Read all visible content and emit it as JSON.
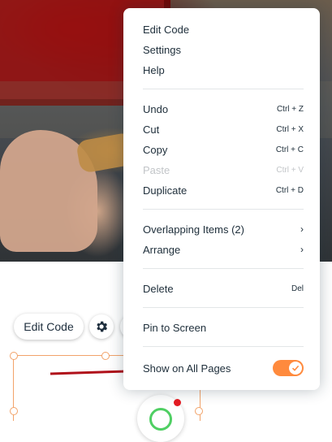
{
  "editor": {
    "edit_code_button": "Edit Code"
  },
  "menu": {
    "items": [
      {
        "label": "Edit Code"
      },
      {
        "label": "Settings"
      },
      {
        "label": "Help"
      },
      {
        "label": "Undo",
        "shortcut": "Ctrl + Z"
      },
      {
        "label": "Cut",
        "shortcut": "Ctrl + X"
      },
      {
        "label": "Copy",
        "shortcut": "Ctrl + C"
      },
      {
        "label": "Paste",
        "shortcut": "Ctrl + V",
        "disabled": true
      },
      {
        "label": "Duplicate",
        "shortcut": "Ctrl + D"
      },
      {
        "label": "Overlapping Items (2)"
      },
      {
        "label": "Arrange"
      },
      {
        "label": "Delete",
        "shortcut": "Del"
      },
      {
        "label": "Pin to Screen"
      },
      {
        "label": "Show on All Pages",
        "toggle_on": true
      }
    ]
  },
  "colors": {
    "accent_orange": "#ff8a3d",
    "arrow_red": "#b0101a",
    "selection_orange": "#f2a36a"
  }
}
